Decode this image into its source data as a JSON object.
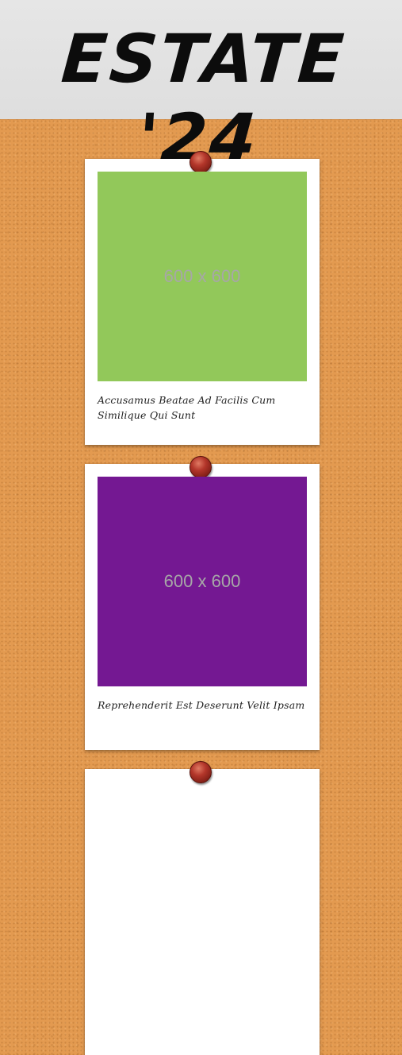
{
  "header": {
    "title": "ESTATE '24"
  },
  "cards": [
    {
      "image_label": "600 x 600",
      "image_color": "#92c85a",
      "caption": "Accusamus Beatae Ad Facilis Cum Similique Qui Sunt"
    },
    {
      "image_label": "600 x 600",
      "image_color": "#741892",
      "caption": "Reprehenderit Est Deserunt Velit Ipsam"
    }
  ],
  "colors": {
    "board": "#e39a50",
    "header_bg": "#e3e3e3",
    "pin": "#b3362a"
  }
}
